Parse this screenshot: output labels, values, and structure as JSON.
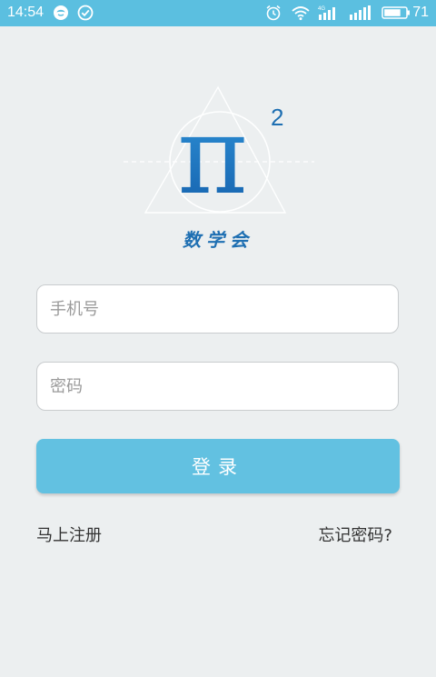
{
  "status_bar": {
    "time": "14:54",
    "left_icons": [
      "qq-icon",
      "check-circle-icon"
    ],
    "right_icons": [
      "alarm-icon",
      "wifi-icon",
      "signal-4g-icon",
      "signal-icon",
      "battery-icon"
    ],
    "network_label": "4G",
    "battery": "71"
  },
  "logo": {
    "symbol": "π",
    "superscript": "2",
    "app_name": "数学会"
  },
  "form": {
    "phone_placeholder": "手机号",
    "phone_value": "",
    "password_placeholder": "密码",
    "password_value": "",
    "login_label": "登录"
  },
  "links": {
    "register": "马上注册",
    "forgot_password": "忘记密码?"
  },
  "colors": {
    "status_bar": "#5BBFE0",
    "background": "#ECEFF0",
    "button": "#62C1E1",
    "logo_blue": "#1E6FB2"
  }
}
